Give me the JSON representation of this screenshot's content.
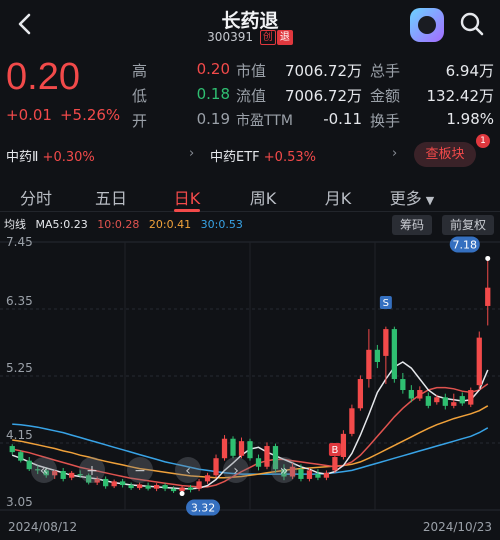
{
  "header": {
    "title": "长药退",
    "code": "300391",
    "tag_board": "创",
    "tag_delist": "退"
  },
  "quote": {
    "price": "0.20",
    "change": "+0.01",
    "change_pct": "+5.26%",
    "stats": [
      {
        "label": "高",
        "value": "0.20"
      },
      {
        "label": "市值",
        "value": "7006.72万"
      },
      {
        "label": "总手",
        "value": "6.94万"
      },
      {
        "label": "低",
        "value": "0.18"
      },
      {
        "label": "流值",
        "value": "7006.72万"
      },
      {
        "label": "金额",
        "value": "132.42万"
      },
      {
        "label": "开",
        "value": "0.19"
      },
      {
        "label": "市盈TTM",
        "value": "-0.11"
      },
      {
        "label": "换手",
        "value": "1.98%"
      }
    ]
  },
  "sector": {
    "name1": "中药Ⅱ",
    "pct1": "+0.30%",
    "name2": "中药ETF",
    "pct2": "+0.53%",
    "button": "查板块",
    "badge": "1"
  },
  "tabs": [
    "分时",
    "五日",
    "日K",
    "周K",
    "月K",
    "更多"
  ],
  "ma_line": {
    "label": "均线",
    "ma5": "MA5:0.23",
    "ma10": "10:0.28",
    "ma20": "20:0.41",
    "ma30": "30:0.53",
    "btn_chips": "筹码",
    "btn_adjust": "前复权"
  },
  "colors": {
    "up": "#f24a4a",
    "down": "#2fbf71",
    "ma5": "#e6e8ec",
    "ma10": "#e0534f",
    "ma20": "#f0a13a",
    "ma30": "#38a3e6",
    "background": "#101216"
  },
  "chart_data": {
    "type": "candlestick",
    "y_ticks": [
      "7.45",
      "6.35",
      "5.25",
      "4.15",
      "3.05"
    ],
    "ylim": [
      3.05,
      7.45
    ],
    "x_start": "2024/08/12",
    "x_end": "2024/10/23",
    "high_label": "7.18",
    "low_label": "3.32",
    "buy_marker": "B",
    "sell_marker": "S",
    "candles": [
      [
        4.1,
        4.0,
        4.13,
        3.96
      ],
      [
        4.0,
        3.86,
        4.03,
        3.83
      ],
      [
        3.86,
        3.72,
        3.92,
        3.69
      ],
      [
        3.72,
        3.7,
        3.78,
        3.64
      ],
      [
        3.7,
        3.62,
        3.74,
        3.58
      ],
      [
        3.62,
        3.69,
        3.71,
        3.56
      ],
      [
        3.69,
        3.56,
        3.74,
        3.52
      ],
      [
        3.58,
        3.66,
        3.69,
        3.54
      ],
      [
        3.64,
        3.62,
        3.7,
        3.58
      ],
      [
        3.62,
        3.5,
        3.65,
        3.47
      ],
      [
        3.5,
        3.56,
        3.6,
        3.46
      ],
      [
        3.56,
        3.44,
        3.6,
        3.4
      ],
      [
        3.44,
        3.52,
        3.55,
        3.41
      ],
      [
        3.52,
        3.46,
        3.56,
        3.42
      ],
      [
        3.46,
        3.41,
        3.5,
        3.38
      ],
      [
        3.41,
        3.47,
        3.5,
        3.38
      ],
      [
        3.45,
        3.4,
        3.5,
        3.37
      ],
      [
        3.4,
        3.46,
        3.49,
        3.36
      ],
      [
        3.46,
        3.4,
        3.49,
        3.36
      ],
      [
        3.4,
        3.36,
        3.44,
        3.33
      ],
      [
        3.36,
        3.42,
        3.46,
        3.32
      ],
      [
        3.42,
        3.38,
        3.46,
        3.34
      ],
      [
        3.4,
        3.52,
        3.56,
        3.36
      ],
      [
        3.52,
        3.62,
        3.66,
        3.48
      ],
      [
        3.62,
        3.9,
        3.96,
        3.58
      ],
      [
        3.9,
        4.22,
        4.28,
        3.86
      ],
      [
        4.22,
        3.94,
        4.26,
        3.9
      ],
      [
        3.94,
        4.18,
        4.24,
        3.9
      ],
      [
        4.18,
        3.9,
        4.22,
        3.86
      ],
      [
        3.9,
        3.76,
        3.96,
        3.7
      ],
      [
        3.76,
        4.1,
        4.16,
        3.72
      ],
      [
        4.1,
        3.72,
        4.14,
        3.66
      ],
      [
        3.72,
        3.6,
        3.8,
        3.54
      ],
      [
        3.6,
        3.76,
        3.82,
        3.56
      ],
      [
        3.72,
        3.56,
        3.8,
        3.52
      ],
      [
        3.56,
        3.7,
        3.74,
        3.52
      ],
      [
        3.64,
        3.58,
        3.72,
        3.54
      ],
      [
        3.58,
        3.66,
        3.7,
        3.54
      ],
      [
        3.7,
        3.92,
        3.98,
        3.66
      ],
      [
        3.92,
        4.3,
        4.36,
        3.88
      ],
      [
        4.3,
        4.72,
        4.78,
        4.26
      ],
      [
        4.72,
        5.2,
        5.26,
        4.68
      ],
      [
        5.2,
        5.68,
        6.02,
        5.06
      ],
      [
        5.68,
        5.48,
        5.76,
        5.38
      ],
      [
        5.58,
        6.02,
        6.06,
        5.12
      ],
      [
        6.02,
        5.2,
        6.06,
        5.14
      ],
      [
        5.2,
        5.02,
        5.3,
        4.96
      ],
      [
        5.02,
        4.88,
        5.1,
        4.82
      ],
      [
        4.88,
        5.02,
        5.08,
        4.84
      ],
      [
        4.92,
        4.76,
        4.98,
        4.72
      ],
      [
        4.82,
        4.9,
        4.94,
        4.78
      ],
      [
        4.9,
        4.76,
        4.96,
        4.7
      ],
      [
        4.76,
        4.82,
        4.96,
        4.72
      ],
      [
        4.92,
        4.8,
        4.98,
        4.76
      ],
      [
        4.78,
        5.02,
        5.06,
        4.74
      ],
      [
        5.1,
        5.88,
        5.98,
        5.02
      ],
      [
        6.4,
        6.7,
        7.18,
        6.08
      ]
    ],
    "ma5": [
      3.95,
      3.9,
      3.84,
      3.78,
      3.74,
      3.7,
      3.66,
      3.62,
      3.6,
      3.58,
      3.56,
      3.53,
      3.5,
      3.48,
      3.46,
      3.45,
      3.44,
      3.43,
      3.42,
      3.41,
      3.4,
      3.4,
      3.41,
      3.45,
      3.55,
      3.7,
      3.82,
      3.95,
      4.05,
      4.08,
      4.0,
      3.94,
      3.88,
      3.82,
      3.76,
      3.72,
      3.66,
      3.64,
      3.68,
      3.78,
      3.98,
      4.28,
      4.62,
      4.98,
      5.2,
      5.4,
      5.48,
      5.38,
      5.2,
      5.02,
      4.92,
      4.88,
      4.86,
      4.84,
      4.86,
      5.02,
      5.35
    ],
    "ma10": [
      4.05,
      4.02,
      3.99,
      3.95,
      3.91,
      3.87,
      3.83,
      3.79,
      3.75,
      3.72,
      3.69,
      3.66,
      3.63,
      3.6,
      3.57,
      3.55,
      3.53,
      3.51,
      3.49,
      3.47,
      3.45,
      3.44,
      3.43,
      3.43,
      3.46,
      3.52,
      3.6,
      3.68,
      3.75,
      3.82,
      3.86,
      3.88,
      3.88,
      3.86,
      3.84,
      3.82,
      3.8,
      3.78,
      3.76,
      3.78,
      3.84,
      3.95,
      4.1,
      4.26,
      4.42,
      4.58,
      4.72,
      4.84,
      4.94,
      5.02,
      5.06,
      5.06,
      5.04,
      5.0,
      4.98,
      5.02,
      5.12
    ],
    "ma20": [
      4.2,
      4.18,
      4.15,
      4.12,
      4.09,
      4.06,
      4.02,
      3.99,
      3.95,
      3.92,
      3.88,
      3.85,
      3.82,
      3.79,
      3.76,
      3.73,
      3.71,
      3.69,
      3.67,
      3.65,
      3.63,
      3.61,
      3.6,
      3.59,
      3.58,
      3.58,
      3.59,
      3.6,
      3.62,
      3.64,
      3.66,
      3.68,
      3.7,
      3.72,
      3.73,
      3.74,
      3.75,
      3.76,
      3.77,
      3.78,
      3.8,
      3.84,
      3.9,
      3.97,
      4.04,
      4.11,
      4.18,
      4.25,
      4.32,
      4.39,
      4.45,
      4.5,
      4.55,
      4.59,
      4.63,
      4.68,
      4.76
    ],
    "ma30": [
      4.46,
      4.45,
      4.43,
      4.41,
      4.38,
      4.35,
      4.32,
      4.28,
      4.24,
      4.2,
      4.16,
      4.12,
      4.08,
      4.04,
      4.0,
      3.96,
      3.92,
      3.88,
      3.84,
      3.81,
      3.78,
      3.75,
      3.72,
      3.7,
      3.68,
      3.66,
      3.65,
      3.64,
      3.64,
      3.64,
      3.64,
      3.64,
      3.64,
      3.64,
      3.64,
      3.64,
      3.64,
      3.65,
      3.66,
      3.68,
      3.7,
      3.74,
      3.78,
      3.82,
      3.86,
      3.9,
      3.94,
      3.98,
      4.02,
      4.06,
      4.1,
      4.14,
      4.18,
      4.22,
      4.26,
      4.32,
      4.4
    ]
  }
}
